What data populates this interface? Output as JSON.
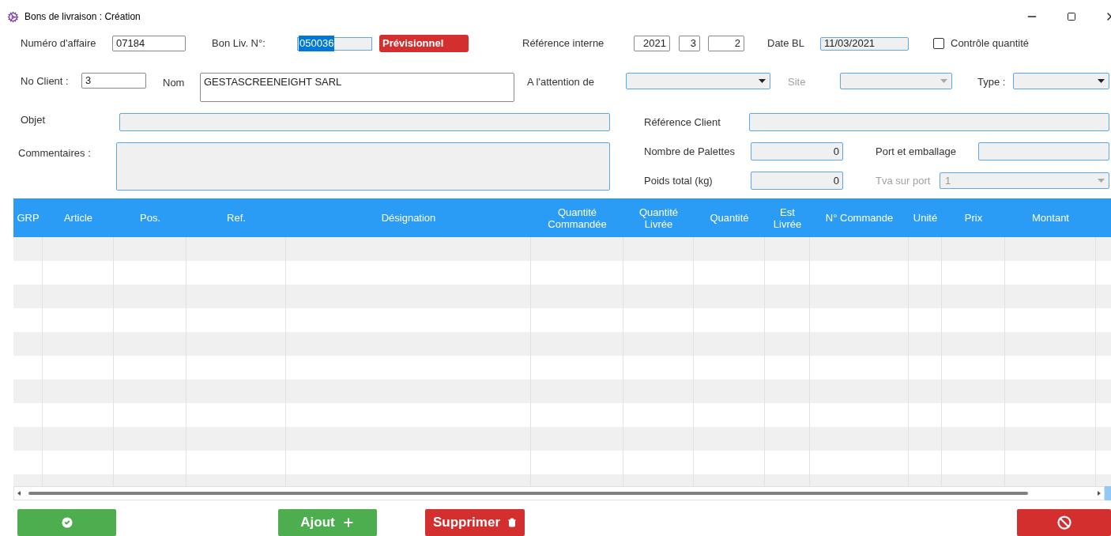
{
  "window": {
    "title": "Bons de livraison : Création"
  },
  "row1": {
    "affaire": {
      "label": "Numéro d'affaire",
      "value": "07184"
    },
    "bon_liv": {
      "label": "Bon Liv. N°:",
      "value": "050036",
      "selected": true
    },
    "status_badge": "Prévisionnel",
    "reference_interne": {
      "label": "Référence interne",
      "values": [
        "2021",
        "3",
        "2"
      ]
    },
    "date_bl": {
      "label": "Date BL",
      "value": "11/03/2021"
    },
    "controle_quantite": {
      "label": "Contrôle quantité",
      "checked": false
    }
  },
  "row2": {
    "client": {
      "label": "No Client :",
      "value": "3"
    },
    "nom": {
      "label": "Nom",
      "value": "GESTASCREENEIGHT SARL"
    },
    "attention": {
      "label": "A l'attention de",
      "disabled": false
    },
    "site": {
      "label": "Site",
      "disabled": true
    },
    "type": {
      "label": "Type :",
      "disabled": false
    }
  },
  "row3": {
    "objet": {
      "label": "Objet"
    },
    "reference_client": {
      "label": "Référence Client"
    }
  },
  "row4": {
    "commentaires": {
      "label": "Commentaires :"
    },
    "palettes": {
      "label": "Nombre de Palettes",
      "value": "0"
    },
    "port": {
      "label": "Port et emballage"
    },
    "poids": {
      "label": "Poids total (kg)",
      "value": "0"
    },
    "tva": {
      "label": "Tva sur port",
      "value": "1",
      "disabled": true
    }
  },
  "table": {
    "columns": [
      "GRP",
      "Article",
      "Pos.",
      "Ref.",
      "Désignation",
      "Quantité Commandée",
      "Quantité Livrée",
      "Quantité",
      "Est Livrée",
      "N° Commande",
      "Unité",
      "Prix",
      "Montant"
    ]
  },
  "buttons": [
    {
      "kind": "validate"
    },
    {
      "kind": "add",
      "label": "Ajout"
    },
    {
      "kind": "delete",
      "label": "Supprimer"
    },
    {
      "kind": "cancel"
    }
  ]
}
